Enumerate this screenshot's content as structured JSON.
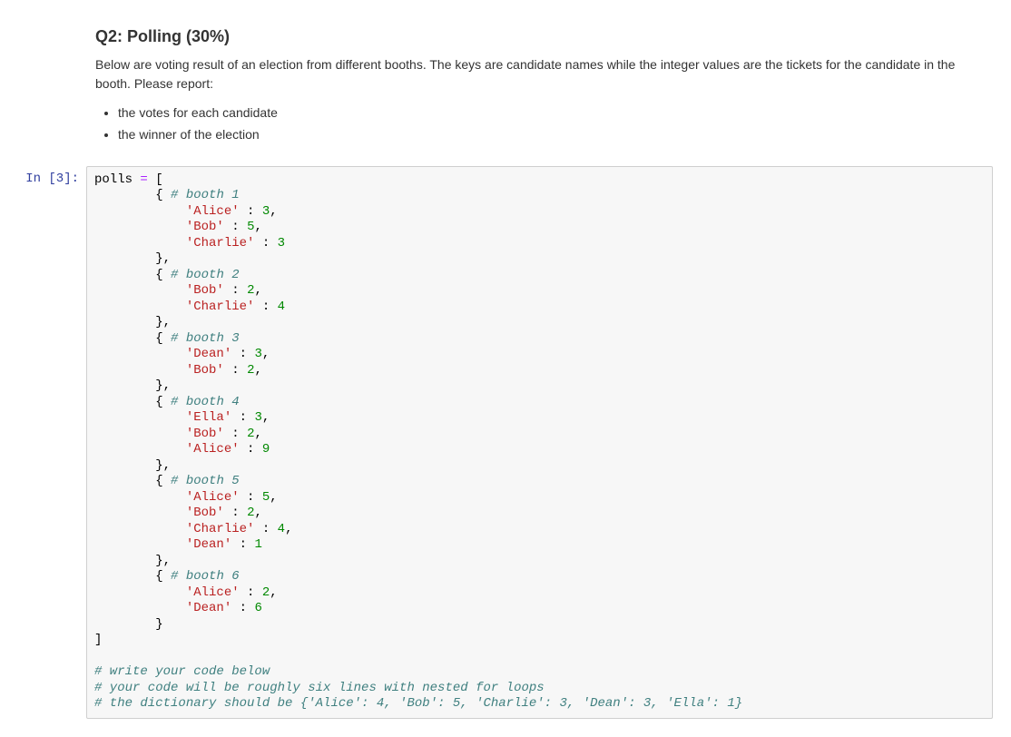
{
  "heading": "Q2: Polling (30%)",
  "intro": "Below are voting result of an election from different booths. The keys are candidate names while the integer values are the tickets for the candidate in the booth. Please report:",
  "bullets": [
    "the votes for each candidate",
    "the winner of the election"
  ],
  "prompt_label": "In  [3]:",
  "code": {
    "var": "polls",
    "eq": " = ",
    "open_list": "[",
    "close_list": "]",
    "booths": [
      {
        "comment": "# booth 1",
        "pairs": [
          [
            "'Alice'",
            "3"
          ],
          [
            "'Bob'",
            "5"
          ],
          [
            "'Charlie'",
            "3"
          ]
        ],
        "trailing_comma_last": false
      },
      {
        "comment": "# booth 2",
        "pairs": [
          [
            "'Bob'",
            "2"
          ],
          [
            "'Charlie'",
            "4"
          ]
        ],
        "trailing_comma_last": false
      },
      {
        "comment": "# booth 3",
        "pairs": [
          [
            "'Dean'",
            "3"
          ],
          [
            "'Bob'",
            "2"
          ]
        ],
        "trailing_comma_last": true
      },
      {
        "comment": "# booth 4",
        "pairs": [
          [
            "'Ella'",
            "3"
          ],
          [
            "'Bob'",
            "2"
          ],
          [
            "'Alice'",
            "9"
          ]
        ],
        "trailing_comma_last": false
      },
      {
        "comment": "# booth 5",
        "pairs": [
          [
            "'Alice'",
            "5"
          ],
          [
            "'Bob'",
            "2"
          ],
          [
            "'Charlie'",
            "4"
          ],
          [
            "'Dean'",
            "1"
          ]
        ],
        "trailing_comma_last": false
      },
      {
        "comment": "# booth 6",
        "pairs": [
          [
            "'Alice'",
            "2"
          ],
          [
            "'Dean'",
            "6"
          ]
        ],
        "trailing_comma_last": false
      }
    ],
    "trail": [
      "",
      "# write your code below",
      "# your code will be roughly six lines with nested for loops",
      "# the dictionary should be {'Alice': 4, 'Bob': 5, 'Charlie': 3, 'Dean': 3, 'Ella': 1}"
    ]
  }
}
